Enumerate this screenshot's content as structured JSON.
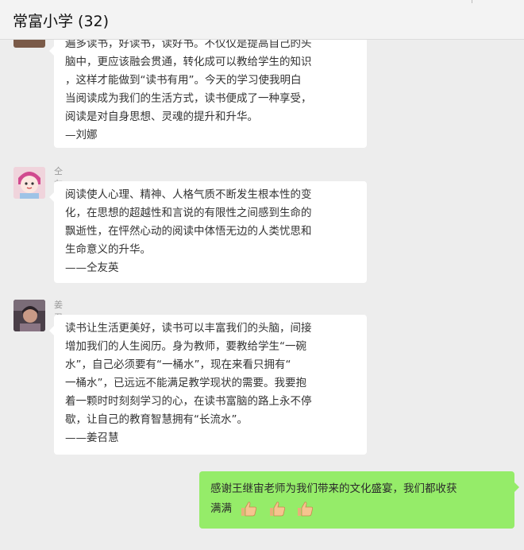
{
  "header": {
    "title": "常富小学 (32)"
  },
  "messages": [
    {
      "sender": "",
      "lines": [
        "遍多读书，好读书，读好书。不仅仅是提高自己的头",
        "脑中，更应该融会贯通，转化成可以教给学生的知识",
        "，这样才能做到“读书有用”。今天的学习使我明白",
        "当阅读成为我们的生活方式，读书便成了一种享受，",
        "阅读是对自身思想、灵魂的提升和升华。",
        "—刘娜"
      ]
    },
    {
      "sender": "仝友英",
      "lines": [
        "阅读使人心理、精神、人格气质不断发生根本性的变",
        "化，在思想的超越性和言说的有限性之间感到生命的",
        "飘逝性，在怦然心动的阅读中体悟无边的人类忧思和",
        "生命意义的升华。",
        "——仝友英"
      ]
    },
    {
      "sender": "姜召慧",
      "lines": [
        "读书让生活更美好，读书可以丰富我们的头脑，间接",
        "增加我们的人生阅历。身为教师，要教给学生“一碗",
        "水”，自己必须要有“一桶水”，现在来看只拥有“",
        "一桶水”，已远远不能满足教学现状的需要。我要抱",
        "着一颗时时刻刻学习的心，在读书富脑的路上永不停",
        "歇，让自己的教育智慧拥有“长流水”。",
        "——姜召慧"
      ]
    },
    {
      "lines": [
        "感谢王继宙老师为我们带来的文化盛宴，我们都收获",
        "满满"
      ],
      "emoji": [
        "thumbs-up-emoji",
        "thumbs-up-emoji",
        "thumbs-up-emoji"
      ]
    }
  ],
  "colors": {
    "mine_bubble": "#95ec69",
    "chat_bg": "#ededed"
  }
}
